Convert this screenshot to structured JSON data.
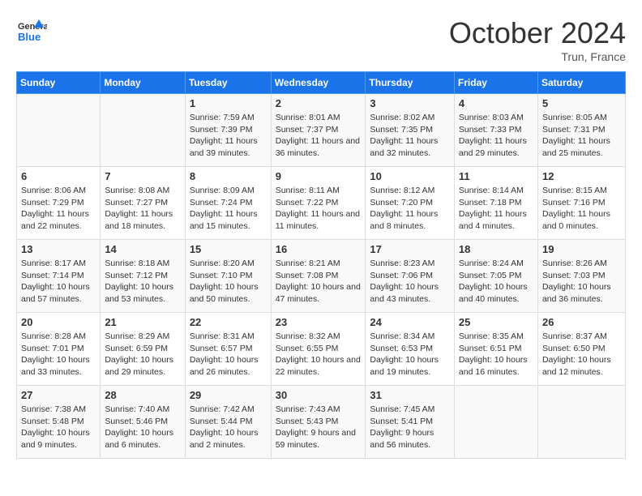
{
  "header": {
    "logo_line1": "General",
    "logo_line2": "Blue",
    "month": "October 2024",
    "location": "Trun, France"
  },
  "weekdays": [
    "Sunday",
    "Monday",
    "Tuesday",
    "Wednesday",
    "Thursday",
    "Friday",
    "Saturday"
  ],
  "weeks": [
    [
      {
        "day": "",
        "sunrise": "",
        "sunset": "",
        "daylight": ""
      },
      {
        "day": "",
        "sunrise": "",
        "sunset": "",
        "daylight": ""
      },
      {
        "day": "1",
        "sunrise": "Sunrise: 7:59 AM",
        "sunset": "Sunset: 7:39 PM",
        "daylight": "Daylight: 11 hours and 39 minutes."
      },
      {
        "day": "2",
        "sunrise": "Sunrise: 8:01 AM",
        "sunset": "Sunset: 7:37 PM",
        "daylight": "Daylight: 11 hours and 36 minutes."
      },
      {
        "day": "3",
        "sunrise": "Sunrise: 8:02 AM",
        "sunset": "Sunset: 7:35 PM",
        "daylight": "Daylight: 11 hours and 32 minutes."
      },
      {
        "day": "4",
        "sunrise": "Sunrise: 8:03 AM",
        "sunset": "Sunset: 7:33 PM",
        "daylight": "Daylight: 11 hours and 29 minutes."
      },
      {
        "day": "5",
        "sunrise": "Sunrise: 8:05 AM",
        "sunset": "Sunset: 7:31 PM",
        "daylight": "Daylight: 11 hours and 25 minutes."
      }
    ],
    [
      {
        "day": "6",
        "sunrise": "Sunrise: 8:06 AM",
        "sunset": "Sunset: 7:29 PM",
        "daylight": "Daylight: 11 hours and 22 minutes."
      },
      {
        "day": "7",
        "sunrise": "Sunrise: 8:08 AM",
        "sunset": "Sunset: 7:27 PM",
        "daylight": "Daylight: 11 hours and 18 minutes."
      },
      {
        "day": "8",
        "sunrise": "Sunrise: 8:09 AM",
        "sunset": "Sunset: 7:24 PM",
        "daylight": "Daylight: 11 hours and 15 minutes."
      },
      {
        "day": "9",
        "sunrise": "Sunrise: 8:11 AM",
        "sunset": "Sunset: 7:22 PM",
        "daylight": "Daylight: 11 hours and 11 minutes."
      },
      {
        "day": "10",
        "sunrise": "Sunrise: 8:12 AM",
        "sunset": "Sunset: 7:20 PM",
        "daylight": "Daylight: 11 hours and 8 minutes."
      },
      {
        "day": "11",
        "sunrise": "Sunrise: 8:14 AM",
        "sunset": "Sunset: 7:18 PM",
        "daylight": "Daylight: 11 hours and 4 minutes."
      },
      {
        "day": "12",
        "sunrise": "Sunrise: 8:15 AM",
        "sunset": "Sunset: 7:16 PM",
        "daylight": "Daylight: 11 hours and 0 minutes."
      }
    ],
    [
      {
        "day": "13",
        "sunrise": "Sunrise: 8:17 AM",
        "sunset": "Sunset: 7:14 PM",
        "daylight": "Daylight: 10 hours and 57 minutes."
      },
      {
        "day": "14",
        "sunrise": "Sunrise: 8:18 AM",
        "sunset": "Sunset: 7:12 PM",
        "daylight": "Daylight: 10 hours and 53 minutes."
      },
      {
        "day": "15",
        "sunrise": "Sunrise: 8:20 AM",
        "sunset": "Sunset: 7:10 PM",
        "daylight": "Daylight: 10 hours and 50 minutes."
      },
      {
        "day": "16",
        "sunrise": "Sunrise: 8:21 AM",
        "sunset": "Sunset: 7:08 PM",
        "daylight": "Daylight: 10 hours and 47 minutes."
      },
      {
        "day": "17",
        "sunrise": "Sunrise: 8:23 AM",
        "sunset": "Sunset: 7:06 PM",
        "daylight": "Daylight: 10 hours and 43 minutes."
      },
      {
        "day": "18",
        "sunrise": "Sunrise: 8:24 AM",
        "sunset": "Sunset: 7:05 PM",
        "daylight": "Daylight: 10 hours and 40 minutes."
      },
      {
        "day": "19",
        "sunrise": "Sunrise: 8:26 AM",
        "sunset": "Sunset: 7:03 PM",
        "daylight": "Daylight: 10 hours and 36 minutes."
      }
    ],
    [
      {
        "day": "20",
        "sunrise": "Sunrise: 8:28 AM",
        "sunset": "Sunset: 7:01 PM",
        "daylight": "Daylight: 10 hours and 33 minutes."
      },
      {
        "day": "21",
        "sunrise": "Sunrise: 8:29 AM",
        "sunset": "Sunset: 6:59 PM",
        "daylight": "Daylight: 10 hours and 29 minutes."
      },
      {
        "day": "22",
        "sunrise": "Sunrise: 8:31 AM",
        "sunset": "Sunset: 6:57 PM",
        "daylight": "Daylight: 10 hours and 26 minutes."
      },
      {
        "day": "23",
        "sunrise": "Sunrise: 8:32 AM",
        "sunset": "Sunset: 6:55 PM",
        "daylight": "Daylight: 10 hours and 22 minutes."
      },
      {
        "day": "24",
        "sunrise": "Sunrise: 8:34 AM",
        "sunset": "Sunset: 6:53 PM",
        "daylight": "Daylight: 10 hours and 19 minutes."
      },
      {
        "day": "25",
        "sunrise": "Sunrise: 8:35 AM",
        "sunset": "Sunset: 6:51 PM",
        "daylight": "Daylight: 10 hours and 16 minutes."
      },
      {
        "day": "26",
        "sunrise": "Sunrise: 8:37 AM",
        "sunset": "Sunset: 6:50 PM",
        "daylight": "Daylight: 10 hours and 12 minutes."
      }
    ],
    [
      {
        "day": "27",
        "sunrise": "Sunrise: 7:38 AM",
        "sunset": "Sunset: 5:48 PM",
        "daylight": "Daylight: 10 hours and 9 minutes."
      },
      {
        "day": "28",
        "sunrise": "Sunrise: 7:40 AM",
        "sunset": "Sunset: 5:46 PM",
        "daylight": "Daylight: 10 hours and 6 minutes."
      },
      {
        "day": "29",
        "sunrise": "Sunrise: 7:42 AM",
        "sunset": "Sunset: 5:44 PM",
        "daylight": "Daylight: 10 hours and 2 minutes."
      },
      {
        "day": "30",
        "sunrise": "Sunrise: 7:43 AM",
        "sunset": "Sunset: 5:43 PM",
        "daylight": "Daylight: 9 hours and 59 minutes."
      },
      {
        "day": "31",
        "sunrise": "Sunrise: 7:45 AM",
        "sunset": "Sunset: 5:41 PM",
        "daylight": "Daylight: 9 hours and 56 minutes."
      },
      {
        "day": "",
        "sunrise": "",
        "sunset": "",
        "daylight": ""
      },
      {
        "day": "",
        "sunrise": "",
        "sunset": "",
        "daylight": ""
      }
    ]
  ]
}
